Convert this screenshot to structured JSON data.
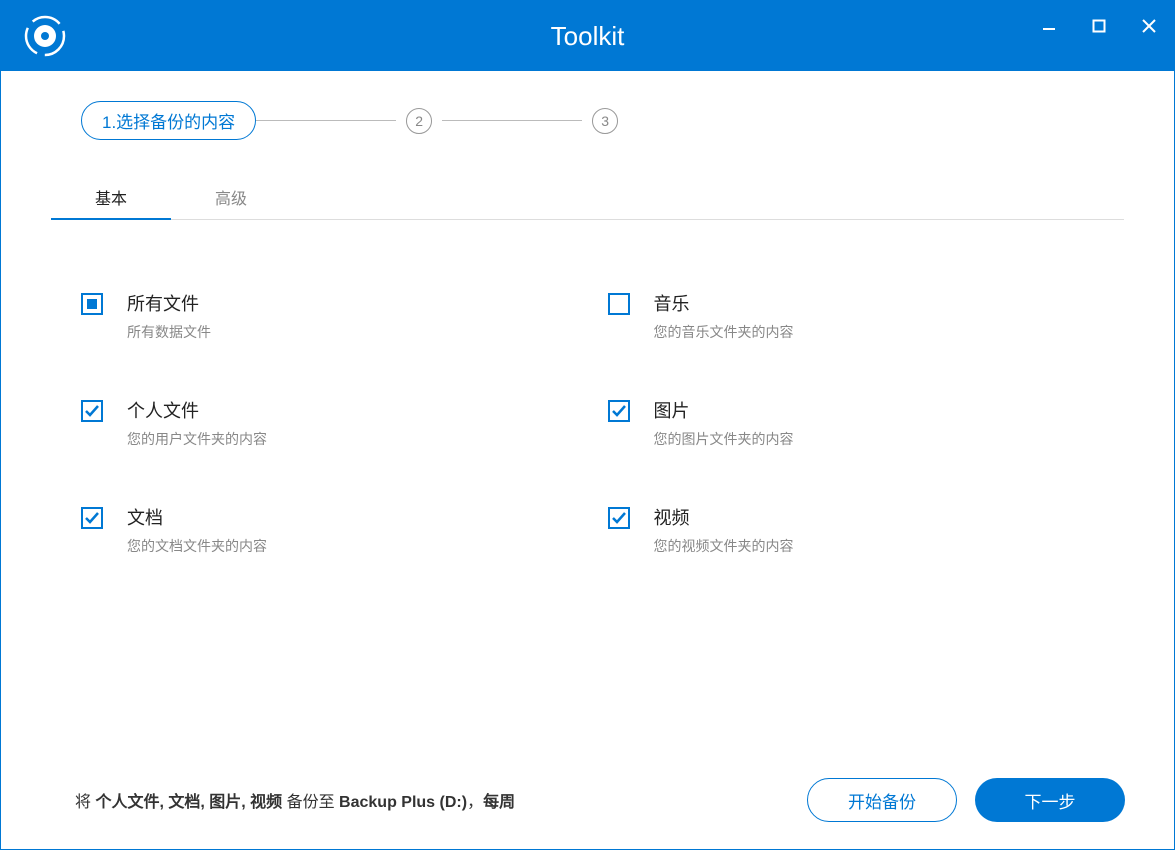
{
  "window": {
    "title": "Toolkit"
  },
  "stepper": {
    "step1_label": "1.选择备份的内容",
    "step2_label": "2",
    "step3_label": "3"
  },
  "tabs": {
    "basic": "基本",
    "advanced": "高级"
  },
  "options": [
    {
      "title": "所有文件",
      "desc": "所有数据文件",
      "state": "indeterminate"
    },
    {
      "title": "音乐",
      "desc": "您的音乐文件夹的内容",
      "state": "unchecked"
    },
    {
      "title": "个人文件",
      "desc": "您的用户文件夹的内容",
      "state": "checked"
    },
    {
      "title": "图片",
      "desc": "您的图片文件夹的内容",
      "state": "checked"
    },
    {
      "title": "文档",
      "desc": "您的文档文件夹的内容",
      "state": "checked"
    },
    {
      "title": "视频",
      "desc": "您的视频文件夹的内容",
      "state": "checked"
    }
  ],
  "summary": {
    "prefix": "将 ",
    "selected": "个人文件, 文档, 图片, 视频",
    "mid": " 备份至 ",
    "destination": "Backup Plus (D:)",
    "sep": "，",
    "frequency": "每周"
  },
  "buttons": {
    "start_backup": "开始备份",
    "next": "下一步"
  }
}
